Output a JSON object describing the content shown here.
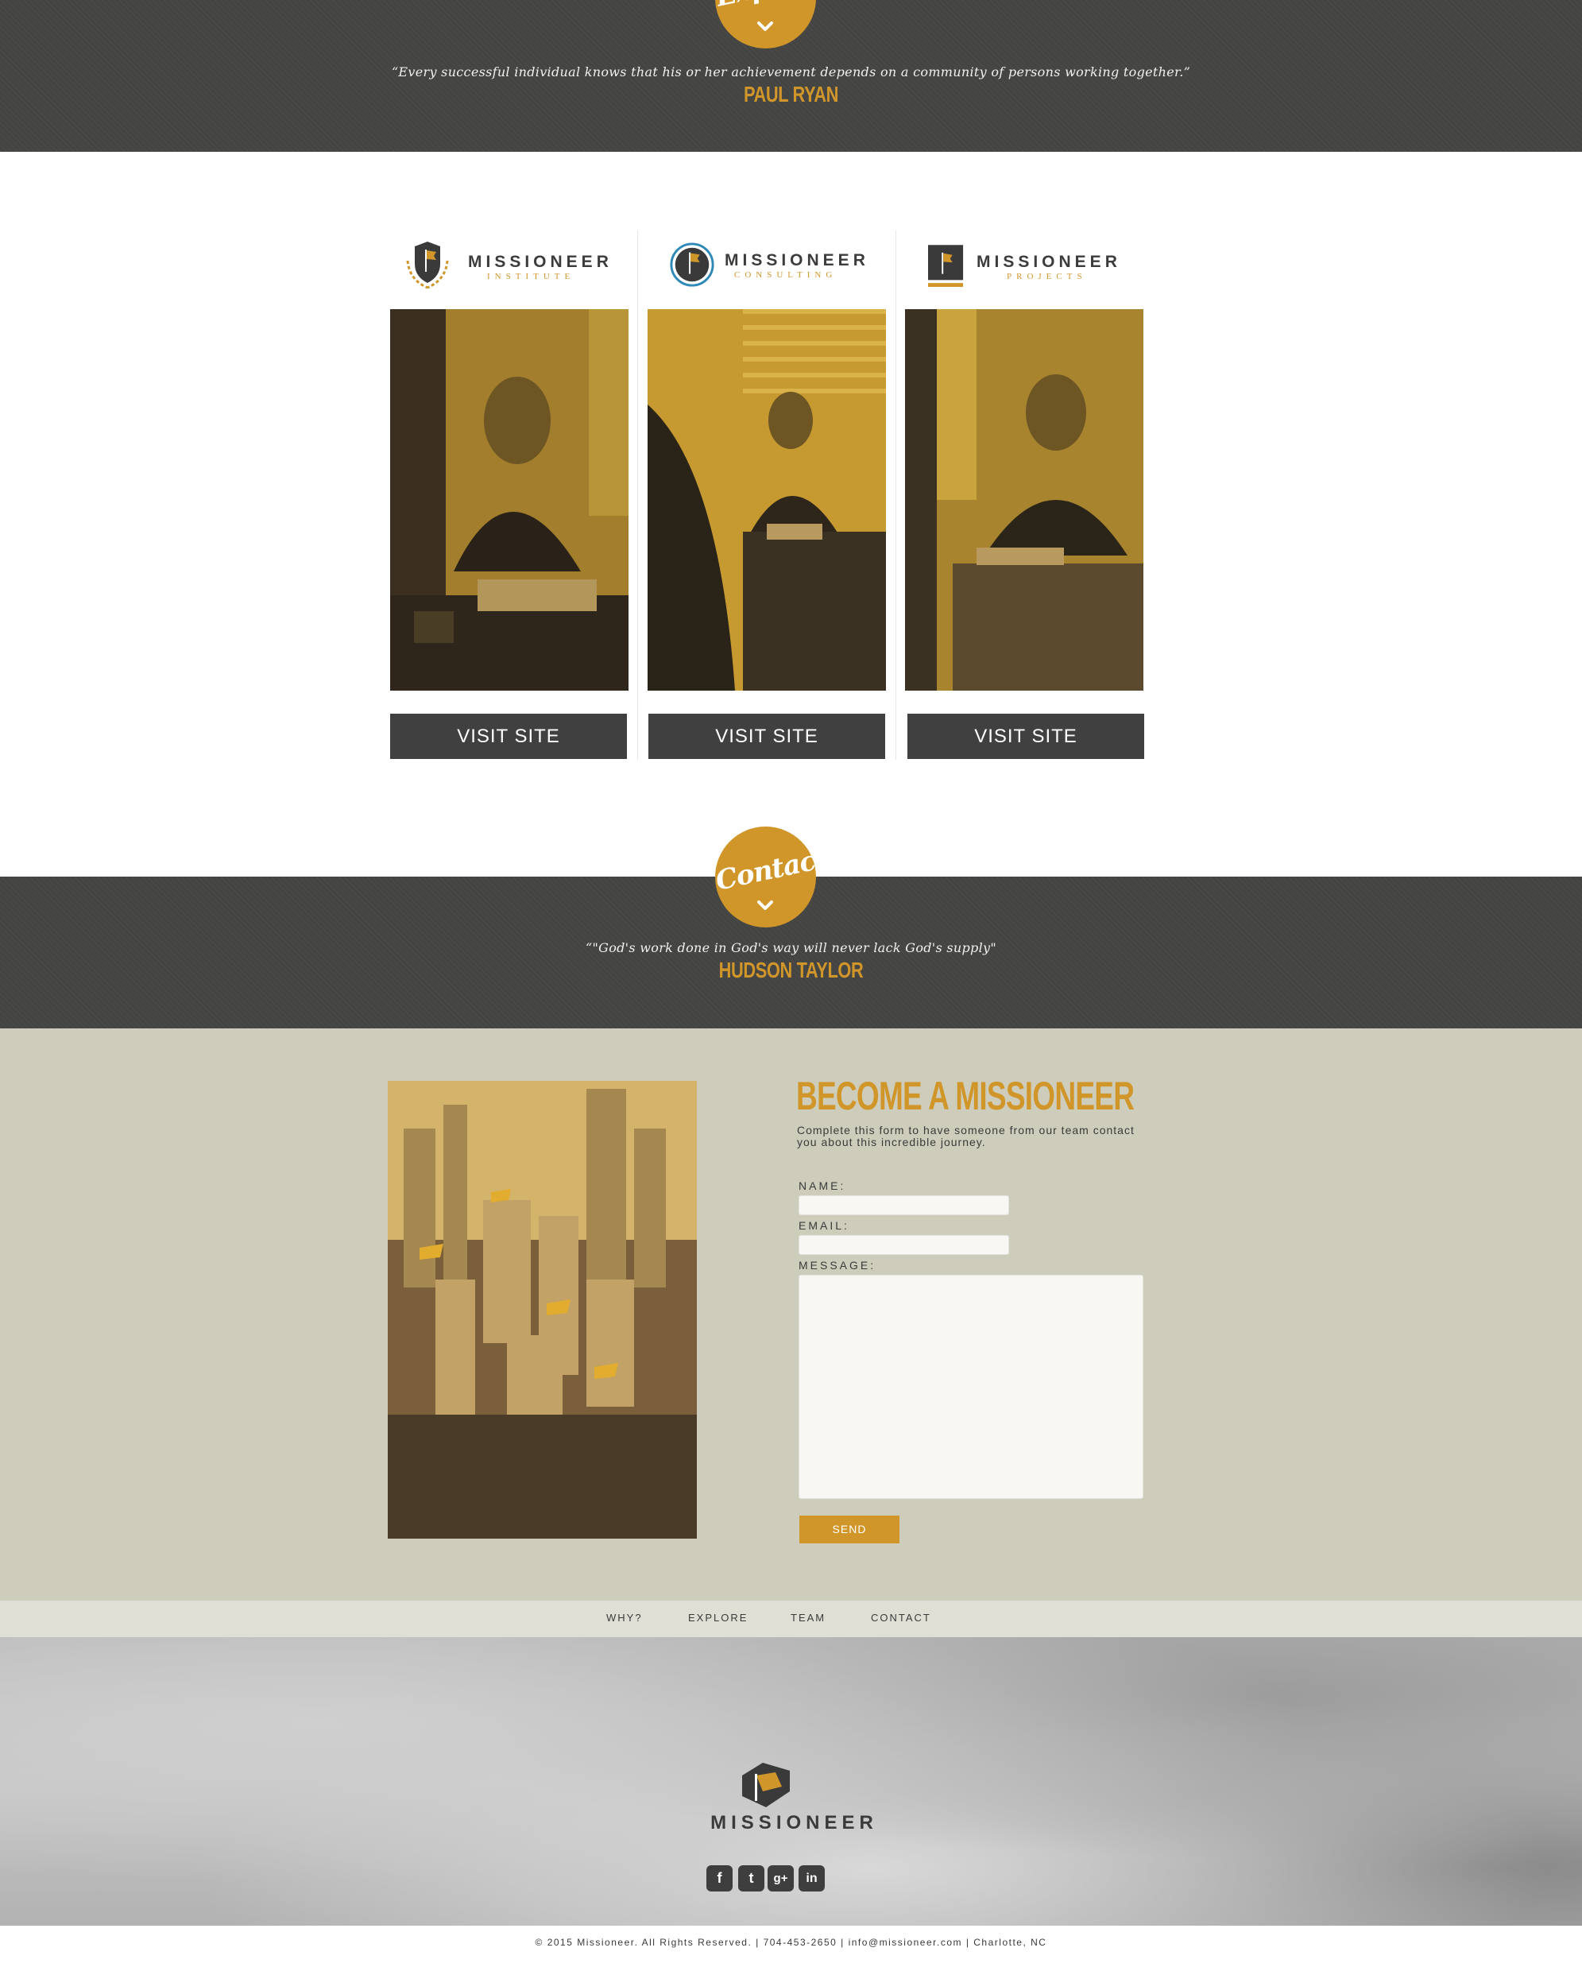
{
  "colors": {
    "accent": "#d1962a",
    "dark_band": "#444442",
    "button_dark": "#404040",
    "contact_bg": "#cecdbb",
    "nav_bg": "#dfdfd5"
  },
  "explore_band": {
    "badge_label": "Explore",
    "quote": "“Every successful individual knows that his or her achievement depends on a community of persons working together.”",
    "author": "PAUL RYAN"
  },
  "sites": [
    {
      "name": "MISSIONEER",
      "sub": "INSTITUTE",
      "button": "VISIT SITE"
    },
    {
      "name": "MISSIONEER",
      "sub": "CONSULTING",
      "button": "VISIT SITE"
    },
    {
      "name": "MISSIONEER",
      "sub": "PROJECTS",
      "button": "VISIT SITE"
    }
  ],
  "contact_band": {
    "badge_label": "Contact",
    "quote": "“\"God's work done in God's way will never lack God's supply\"",
    "author": "HUDSON TAYLOR"
  },
  "form": {
    "title": "BECOME A MISSIONEER",
    "description": "Complete this form to have someone from our team contact you about this incredible journey.",
    "name_label": "NAME:",
    "email_label": "EMAIL:",
    "message_label": "MESSAGE:",
    "name_value": "",
    "email_value": "",
    "message_value": "",
    "send_label": "SEND"
  },
  "footer_nav": [
    "WHY?",
    "EXPLORE",
    "TEAM",
    "CONTACT"
  ],
  "footer": {
    "logo_name": "MISSIONEER",
    "social": [
      {
        "icon": "facebook-icon",
        "glyph": "f"
      },
      {
        "icon": "twitter-icon",
        "glyph": "t"
      },
      {
        "icon": "google-plus-icon",
        "glyph": "g+"
      },
      {
        "icon": "linkedin-icon",
        "glyph": "in"
      }
    ],
    "copyright": "© 2015 Missioneer. All Rights Reserved. | 704-453-2650 | info@missioneer.com | Charlotte, NC"
  }
}
